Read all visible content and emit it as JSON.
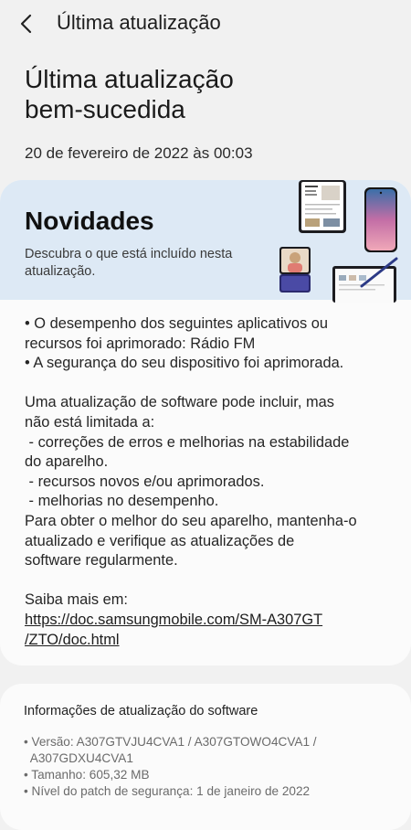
{
  "header": {
    "title": "Última atualização",
    "back_icon": "chevron-left-icon"
  },
  "status": {
    "title_line1": "Última atualização",
    "title_line2": "bem-sucedida",
    "date": "20 de fevereiro de 2022 às 00:03"
  },
  "banner": {
    "title": "Novidades",
    "subtitle": "Descubra o que está incluído nesta atualização.",
    "colors": {
      "background": "#dde9f5"
    }
  },
  "notes": {
    "lines": [
      "• O desempenho dos seguintes aplicativos ou",
      "recursos foi aprimorado: Rádio FM",
      "• A segurança do seu dispositivo foi aprimorada.",
      "",
      "Uma atualização de software pode incluir, mas",
      "não está limitada a:",
      " - correções de erros e melhorias na estabilidade",
      "do aparelho.",
      " - recursos novos e/ou aprimorados.",
      " - melhorias no desempenho.",
      "Para obter o melhor do seu aparelho, mantenha-o",
      "atualizado e verifique as atualizações de",
      "software regularmente.",
      ""
    ],
    "learn_more": "Saiba mais em:",
    "link_line1": "https://doc.samsungmobile.com/SM-A307GT",
    "link_line2": "/ZTO/doc.html"
  },
  "software_info": {
    "title": "Informações de atualização do software",
    "lines": [
      "• Versão: A307GTVJU4CVA1 / A307GTOWO4CVA1 /",
      "  A307GDXU4CVA1",
      "• Tamanho: 605,32 MB",
      "• Nível do patch de segurança: 1 de janeiro de 2022"
    ]
  }
}
